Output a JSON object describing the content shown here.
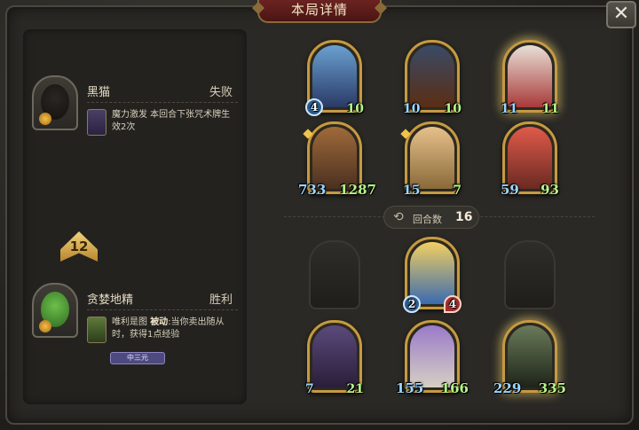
{
  "window": {
    "title": "本局详情",
    "close_label": "✕"
  },
  "players": [
    {
      "name": "黑猫",
      "result": "失败",
      "card_desc": "魔力激发 本回合下张咒术牌生效2次",
      "portrait_icon": "black-cat-portrait"
    },
    {
      "name": "贪婪地精",
      "result": "胜利",
      "card_desc_prefix": "唯利是图 ",
      "card_desc_bold": "被动",
      "card_desc_suffix": ":当你卖出随从时，获得1点经验",
      "tag": "中三元",
      "portrait_icon": "greedy-goblin-portrait"
    }
  ],
  "rank": "12",
  "turn": {
    "label": "回合数",
    "value": "16"
  },
  "enemy_board": [
    {
      "name": "elf-witch",
      "attack": "4",
      "health": "10",
      "color": "#3b5a8a"
    },
    {
      "name": "treant",
      "attack": "10",
      "health": "10",
      "color": "#3d2a1a"
    },
    {
      "name": "clown",
      "attack": "11",
      "health": "11",
      "color": "#a83a3a"
    },
    {
      "name": "pumpkin-head",
      "attack": "733",
      "health": "1287",
      "color": "#7a4a22"
    },
    {
      "name": "deer-girl",
      "attack": "15",
      "health": "7",
      "color": "#c89a5a"
    },
    {
      "name": "red-devil",
      "attack": "59",
      "health": "93",
      "color": "#b8433a"
    }
  ],
  "player_board": [
    {
      "name": "pinocchio",
      "attack": "2",
      "health": "4",
      "color": "#4a78b8"
    },
    {
      "name": "horned-succubus",
      "attack": "7",
      "health": "21",
      "color": "#4a3a6a"
    },
    {
      "name": "griffin",
      "attack": "155",
      "health": "166",
      "color": "#7a6a9a"
    },
    {
      "name": "goblin-king",
      "attack": "229",
      "health": "335",
      "color": "#3f4a3a"
    }
  ]
}
